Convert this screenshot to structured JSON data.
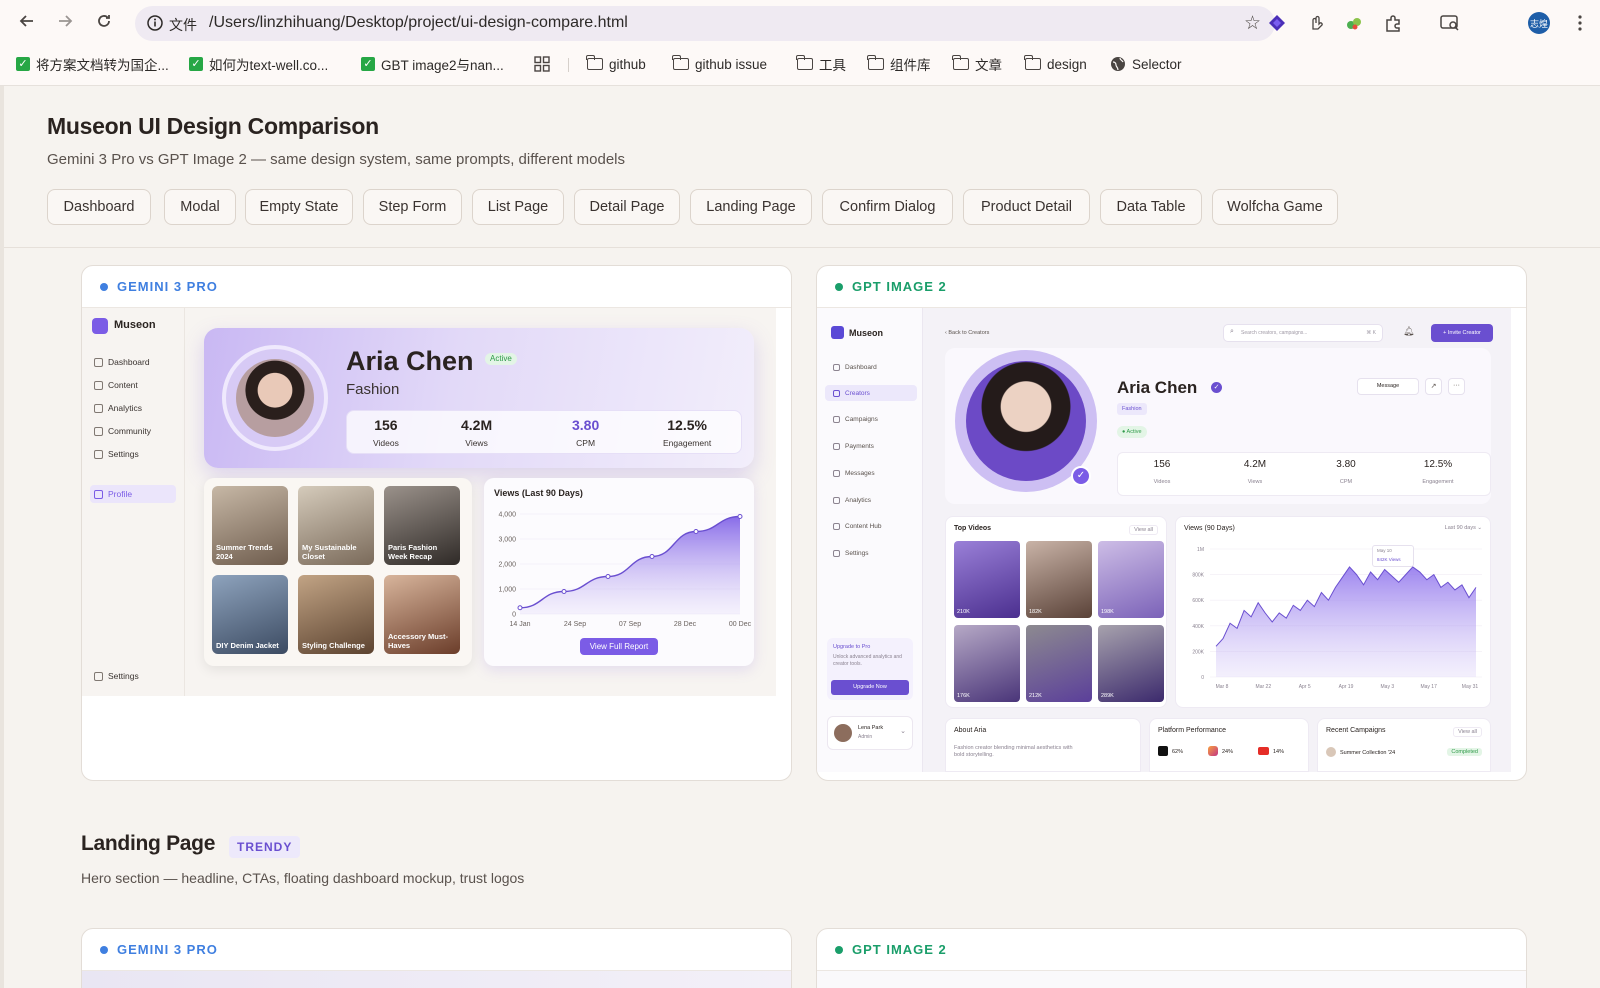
{
  "browser": {
    "scheme_label": "文件",
    "url": "/Users/linzhihuang/Desktop/project/ui-design-compare.html",
    "profile_initials": "志煌",
    "bookmarks": [
      {
        "label": "将方案文档转为国企...",
        "type": "check"
      },
      {
        "label": "如何为text-well.co...",
        "type": "check"
      },
      {
        "label": "GBT image2与nan...",
        "type": "check"
      },
      {
        "label": "",
        "type": "apps"
      },
      {
        "label": "github",
        "type": "folder"
      },
      {
        "label": "github issue",
        "type": "folder"
      },
      {
        "label": "工具",
        "type": "folder"
      },
      {
        "label": "组件库",
        "type": "folder"
      },
      {
        "label": "文章",
        "type": "folder"
      },
      {
        "label": "design",
        "type": "folder"
      },
      {
        "label": "Selector",
        "type": "globe"
      }
    ]
  },
  "page": {
    "title": "Museon UI Design Comparison",
    "subtitle": "Gemini 3 Pro vs GPT Image 2 — same design system, same prompts, different models",
    "tabs": [
      "Dashboard",
      "Modal",
      "Empty State",
      "Step Form",
      "List Page",
      "Detail Page",
      "Landing Page",
      "Confirm Dialog",
      "Product Detail",
      "Data Table",
      "Wolfcha Game"
    ]
  },
  "detail_section": {
    "left_label": "GEMINI 3 PRO",
    "right_label": "GPT IMAGE 2",
    "left_color": "#3f7fe0",
    "right_color": "#1a9e6a",
    "gemini": {
      "brand": "Museon",
      "nav": [
        "Dashboard",
        "Content",
        "Analytics",
        "Community",
        "Settings"
      ],
      "active_nav": "Profile",
      "bottom_nav": "Settings",
      "name": "Aria Chen",
      "status": "Active",
      "category": "Fashion",
      "stats": [
        {
          "value": "156",
          "label": "Videos"
        },
        {
          "value": "4.2M",
          "label": "Views"
        },
        {
          "value": "3.80",
          "label": "CPM"
        },
        {
          "value": "12.5%",
          "label": "Engagement"
        }
      ],
      "videos": [
        "Summer Trends 2024",
        "My Sustainable Closet",
        "Paris Fashion Week Recap",
        "DIY Denim Jacket",
        "Styling Challenge",
        "Accessory Must-Haves"
      ],
      "chart_title": "Views (Last 90 Days)",
      "chart_button": "View Full Report",
      "chart_data": {
        "type": "area",
        "x_ticks": [
          "14 Jan",
          "24 Sep",
          "07 Sep",
          "28 Dec",
          "00 Dec"
        ],
        "y_ticks": [
          "0",
          "1,000",
          "2,000",
          "3,000",
          "4,000"
        ],
        "ylim": [
          0,
          4000
        ],
        "values": [
          250,
          900,
          1500,
          2300,
          3300,
          3900
        ]
      }
    },
    "gpt": {
      "brand": "Museon",
      "back_link": "Back to Creators",
      "search_placeholder": "Search creators, campaigns...",
      "search_shortcut": "⌘ K",
      "invite_button": "Invite Creator",
      "nav": [
        "Dashboard",
        "Creators",
        "Campaigns",
        "Payments",
        "Messages",
        "Analytics",
        "Content Hub",
        "Settings"
      ],
      "active_nav": "Creators",
      "upgrade_title": "Upgrade to Pro",
      "upgrade_text": "Unlock advanced analytics and creator tools.",
      "upgrade_button": "Upgrade Now",
      "user_name": "Lena Park",
      "user_role": "Admin",
      "name": "Aria Chen",
      "tag": "Fashion",
      "status": "Active",
      "message_button": "Message",
      "stats": [
        {
          "value": "156",
          "label": "Videos"
        },
        {
          "value": "4.2M",
          "label": "Views"
        },
        {
          "value": "3.80",
          "label": "CPM"
        },
        {
          "value": "12.5%",
          "label": "Engagement"
        }
      ],
      "top_videos_title": "Top Videos",
      "view_all": "View all",
      "video_counts": [
        "210K",
        "182K",
        "198K",
        "176K",
        "212K",
        "289K"
      ],
      "chart_title": "Views (90 Days)",
      "chart_range": "Last 90 days",
      "tooltip_date": "May 10",
      "tooltip_value": "842K Views",
      "chart_data": {
        "type": "area",
        "x_ticks": [
          "Mar 8",
          "Mar 22",
          "Apr 5",
          "Apr 19",
          "May 3",
          "May 17",
          "May 31"
        ],
        "y_ticks": [
          "0",
          "200K",
          "400K",
          "600K",
          "800K",
          "1M"
        ],
        "ylim": [
          0,
          1000000
        ]
      },
      "about_title": "About Aria",
      "about_text": "Fashion creator blending minimal aesthetics with bold storytelling.",
      "perf_title": "Platform Performance",
      "perf": [
        {
          "platform": "TikTok",
          "value": "62%"
        },
        {
          "platform": "Instagram",
          "value": "24%"
        },
        {
          "platform": "YouTube",
          "value": "14%"
        }
      ],
      "campaigns_title": "Recent Campaigns",
      "campaign_name": "Summer Collection '24",
      "campaign_status": "Completed"
    }
  },
  "landing_section": {
    "title": "Landing Page",
    "badge": "TRENDY",
    "subtitle": "Hero section — headline, CTAs, floating dashboard mockup, trust logos",
    "left_label": "GEMINI 3 PRO",
    "right_label": "GPT IMAGE 2"
  }
}
